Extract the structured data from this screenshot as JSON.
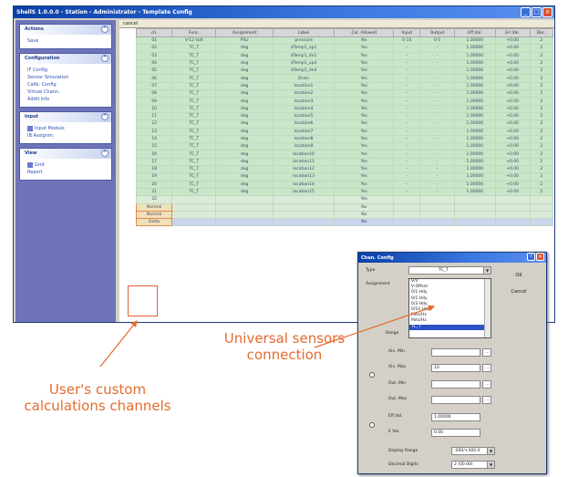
{
  "window": {
    "title": "ShellS 1.0.0.0 - Station - Administrator - Template Config"
  },
  "sidebar": [
    {
      "title": "Actions",
      "items": [
        "Save"
      ]
    },
    {
      "title": "Configuration",
      "items": [
        "IF Config",
        "Sensor Simulation",
        "Calib. Config",
        "Virtual Chann.",
        "Addtl.Info"
      ]
    },
    {
      "title": "Input",
      "items": [
        "Input Module",
        "IB Assignm."
      ]
    },
    {
      "title": "View",
      "items": [
        "Grid",
        "Report"
      ]
    }
  ],
  "toolbar": {
    "label": "cancel"
  },
  "table": {
    "columns": [
      "ch.",
      "Func.",
      "Assignment",
      "Label",
      "Cal. Allowed",
      "Input",
      "Output",
      "Eff.Val.",
      "Err.Val.",
      "Dec."
    ],
    "rows": [
      [
        "01",
        "V-12 Volt",
        "PSU",
        "pressure",
        "No",
        "0-10",
        "0-5",
        "1.00000",
        "+0.00",
        "2"
      ],
      [
        "02",
        "TC_T",
        "deg",
        "dTemp1_up1",
        "Yes",
        "-",
        "-",
        "1.00000",
        "+0.00",
        "2"
      ],
      [
        "03",
        "TC_T",
        "deg",
        "dTemp1_dn1",
        "Yes",
        "-",
        "-",
        "1.00000",
        "+0.00",
        "2"
      ],
      [
        "04",
        "TC_T",
        "deg",
        "dTemp1_up4",
        "Yes",
        "-",
        "-",
        "1.00000",
        "+0.00",
        "2"
      ],
      [
        "05",
        "TC_T",
        "deg",
        "dTemp1_dn4",
        "Yes",
        "-",
        "-",
        "1.00000",
        "+0.00",
        "2"
      ],
      [
        "06",
        "TC_T",
        "deg",
        "Drain",
        "Yes",
        "-",
        "-",
        "1.00000",
        "+0.00",
        "2"
      ],
      [
        "07",
        "TC_T",
        "deg",
        "location1",
        "Yes",
        "-",
        "-",
        "1.00000",
        "+0.00",
        "2"
      ],
      [
        "08",
        "TC_T",
        "deg",
        "location2",
        "Yes",
        "-",
        "-",
        "1.00000",
        "+0.00",
        "2"
      ],
      [
        "09",
        "TC_T",
        "deg",
        "location3",
        "Yes",
        "-",
        "-",
        "1.00000",
        "+0.00",
        "2"
      ],
      [
        "10",
        "TC_T",
        "deg",
        "location4",
        "Yes",
        "-",
        "-",
        "1.00000",
        "+0.00",
        "2"
      ],
      [
        "11",
        "TC_T",
        "deg",
        "location5",
        "Yes",
        "-",
        "-",
        "1.00000",
        "+0.00",
        "2"
      ],
      [
        "12",
        "TC_T",
        "deg",
        "location6",
        "Yes",
        "-",
        "-",
        "1.00000",
        "+0.00",
        "2"
      ],
      [
        "13",
        "TC_T",
        "deg",
        "location7",
        "Yes",
        "-",
        "-",
        "1.00000",
        "+0.00",
        "2"
      ],
      [
        "14",
        "TC_T",
        "deg",
        "location8",
        "Yes",
        "-",
        "-",
        "1.00000",
        "+0.00",
        "2"
      ],
      [
        "15",
        "TC_T",
        "deg",
        "location9",
        "Yes",
        "-",
        "-",
        "1.00000",
        "+0.00",
        "2"
      ],
      [
        "16",
        "TC_T",
        "deg",
        "location10",
        "Yes",
        "-",
        "-",
        "1.00000",
        "+0.00",
        "2"
      ],
      [
        "17",
        "TC_T",
        "deg",
        "location11",
        "Yes",
        "-",
        "-",
        "1.00000",
        "+0.00",
        "2"
      ],
      [
        "18",
        "TC_T",
        "deg",
        "location12",
        "Yes",
        "-",
        "-",
        "1.00000",
        "+0.00",
        "2"
      ],
      [
        "19",
        "TC_T",
        "deg",
        "location13",
        "Yes",
        "-",
        "-",
        "1.00000",
        "+0.00",
        "2"
      ],
      [
        "20",
        "TC_T",
        "deg",
        "location14",
        "Yes",
        "-",
        "-",
        "1.00000",
        "+0.00",
        "2"
      ],
      [
        "21",
        "TC_T",
        "deg",
        "location15",
        "Yes",
        "-",
        "-",
        "1.00000",
        "+0.00",
        "2"
      ],
      [
        "22",
        "",
        "",
        "",
        "Yes",
        "",
        "",
        "",
        "",
        ""
      ]
    ],
    "custom_rows": [
      [
        "Normal",
        "",
        "",
        "",
        "No",
        "",
        "",
        "",
        "",
        ""
      ],
      [
        "Normal",
        "",
        "",
        "",
        "No",
        "",
        "",
        "",
        "",
        ""
      ],
      [
        "Delta",
        "",
        "",
        "",
        "No",
        "",
        "",
        "",
        "",
        ""
      ]
    ]
  },
  "dialog": {
    "title": "Chan. Config",
    "type_label": "Type",
    "type_value": "TC_T",
    "assignment_label": "Assignment",
    "ok": "OK",
    "cancel": "Cancel",
    "list_items": [
      "V/V",
      "V-Offset",
      "0/1 Hdy",
      "0/1 Hdy",
      "0/3 Hdy",
      "0/10 Hdy",
      "Pots/Hz",
      "Pots/Hz",
      "TC_T"
    ],
    "range_label": "Range",
    "fields": [
      {
        "label": "Ain. Min",
        "value": ""
      },
      {
        "label": "Ain. Max",
        "value": "10"
      },
      {
        "label": "Out. Min",
        "value": ""
      },
      {
        "label": "Out. Max",
        "value": ""
      },
      {
        "label": "Eff.Val.",
        "value": "1.00000"
      },
      {
        "label": "E Val.",
        "value": "0.00"
      }
    ],
    "display_range_label": "Display Range",
    "display_range_value": "-200/+300.0",
    "decimal_digits_label": "Decimal Digits",
    "decimal_digits_value": "2 (00.00)"
  },
  "annotations": {
    "universal": "Universal sensors\nconnection",
    "custom": "User's custom\ncalculations channels"
  },
  "colors": {
    "titlebar": "#0a3fa6",
    "row_green": "#c8e6c8",
    "annotation": "#e56b2e",
    "sidebar": "#6f74b8"
  }
}
